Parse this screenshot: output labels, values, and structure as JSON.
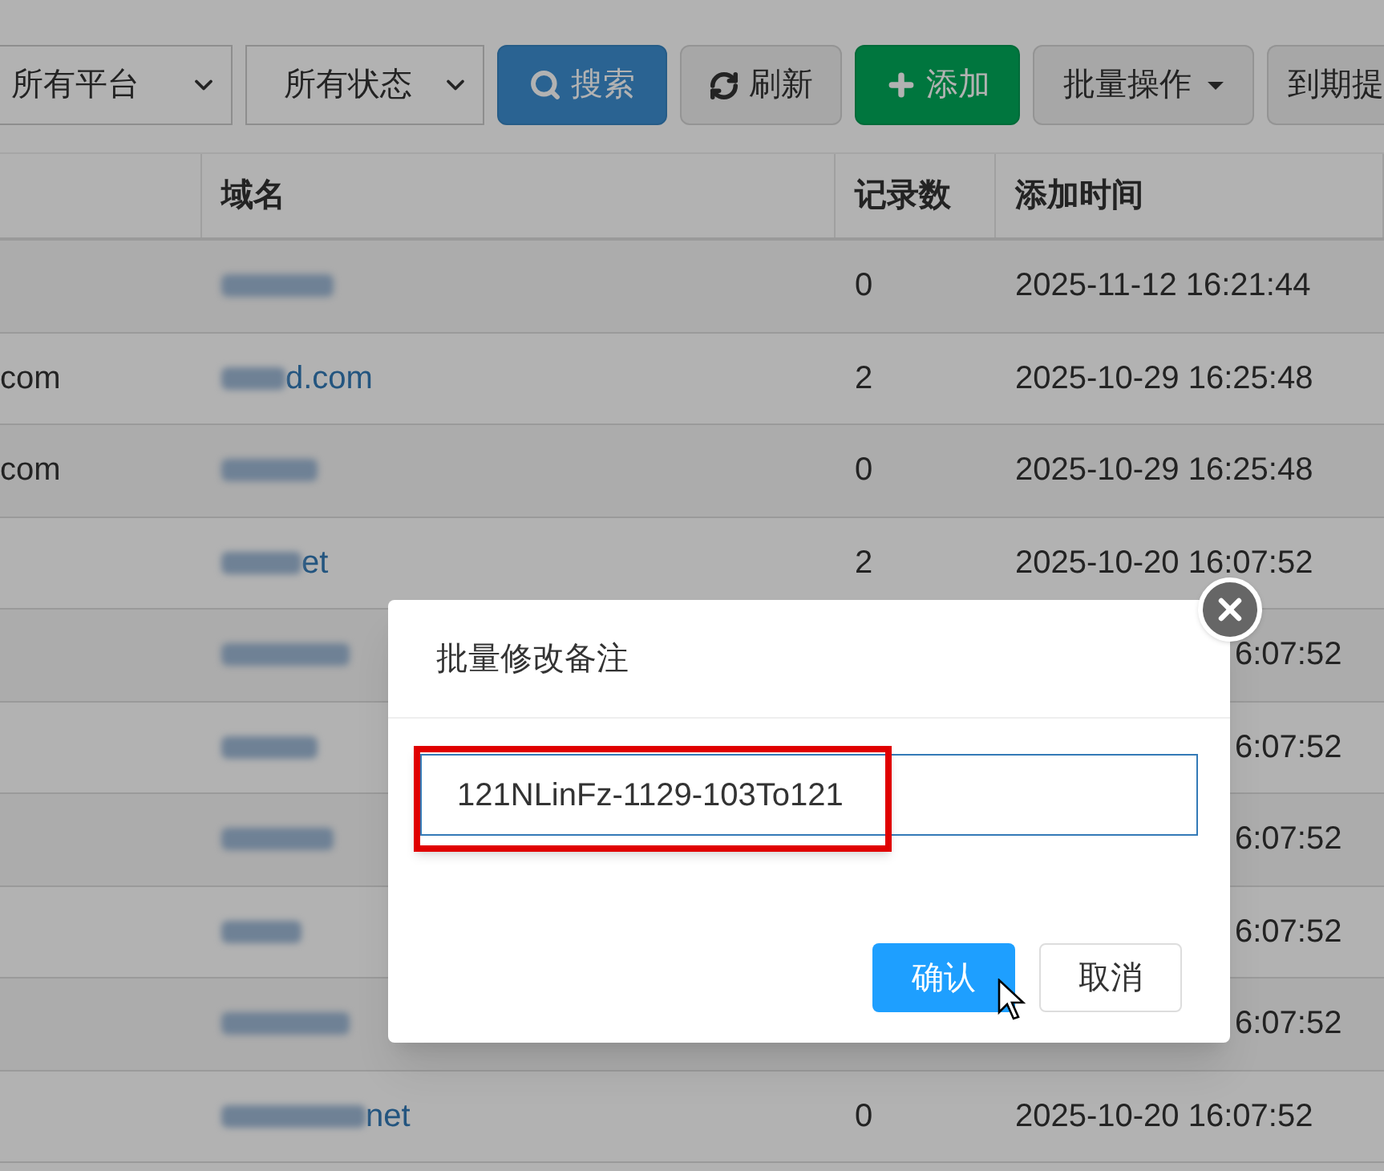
{
  "toolbar": {
    "selects": [
      "所有平台",
      "所有状态"
    ],
    "buttons": [
      {
        "kind": "search",
        "label": "搜索"
      },
      {
        "kind": "refresh",
        "label": "刷新"
      },
      {
        "kind": "add",
        "label": "添加"
      },
      {
        "kind": "dropdown",
        "label": "批量操作"
      },
      {
        "kind": "plain",
        "label": "到期提"
      }
    ]
  },
  "table": {
    "columns": [
      "域名",
      "记录数",
      "添加时间"
    ],
    "rows": [
      {
        "domain": "",
        "records": "0",
        "added": "2025-11-12 16:21:44"
      },
      {
        "column_1": "com",
        "domain": "d.com",
        "records": "2",
        "added": "2025-10-29 16:25:48"
      },
      {
        "column_1": "com",
        "domain": "",
        "records": "0",
        "added": "2025-10-29 16:25:48"
      },
      {
        "domain": "et",
        "records": "2",
        "added": "2025-10-20 16:07:52"
      },
      {
        "domain": "",
        "added": "6:07:52"
      },
      {
        "domain": "",
        "added": "6:07:52"
      },
      {
        "domain": "",
        "added": "6:07:52"
      },
      {
        "domain": "",
        "added": "6:07:52"
      },
      {
        "domain": "",
        "added": "6:07:52"
      },
      {
        "domain": "net",
        "records": "0",
        "added": "2025-10-20 16:07:52"
      }
    ]
  },
  "dialog": {
    "title": "批量修改备注",
    "input_value": "121NLinFz-1129-103To121",
    "buttons": [
      {
        "kind": "primary",
        "label": "确认"
      },
      {
        "kind": "default",
        "label": "取消"
      }
    ]
  }
}
